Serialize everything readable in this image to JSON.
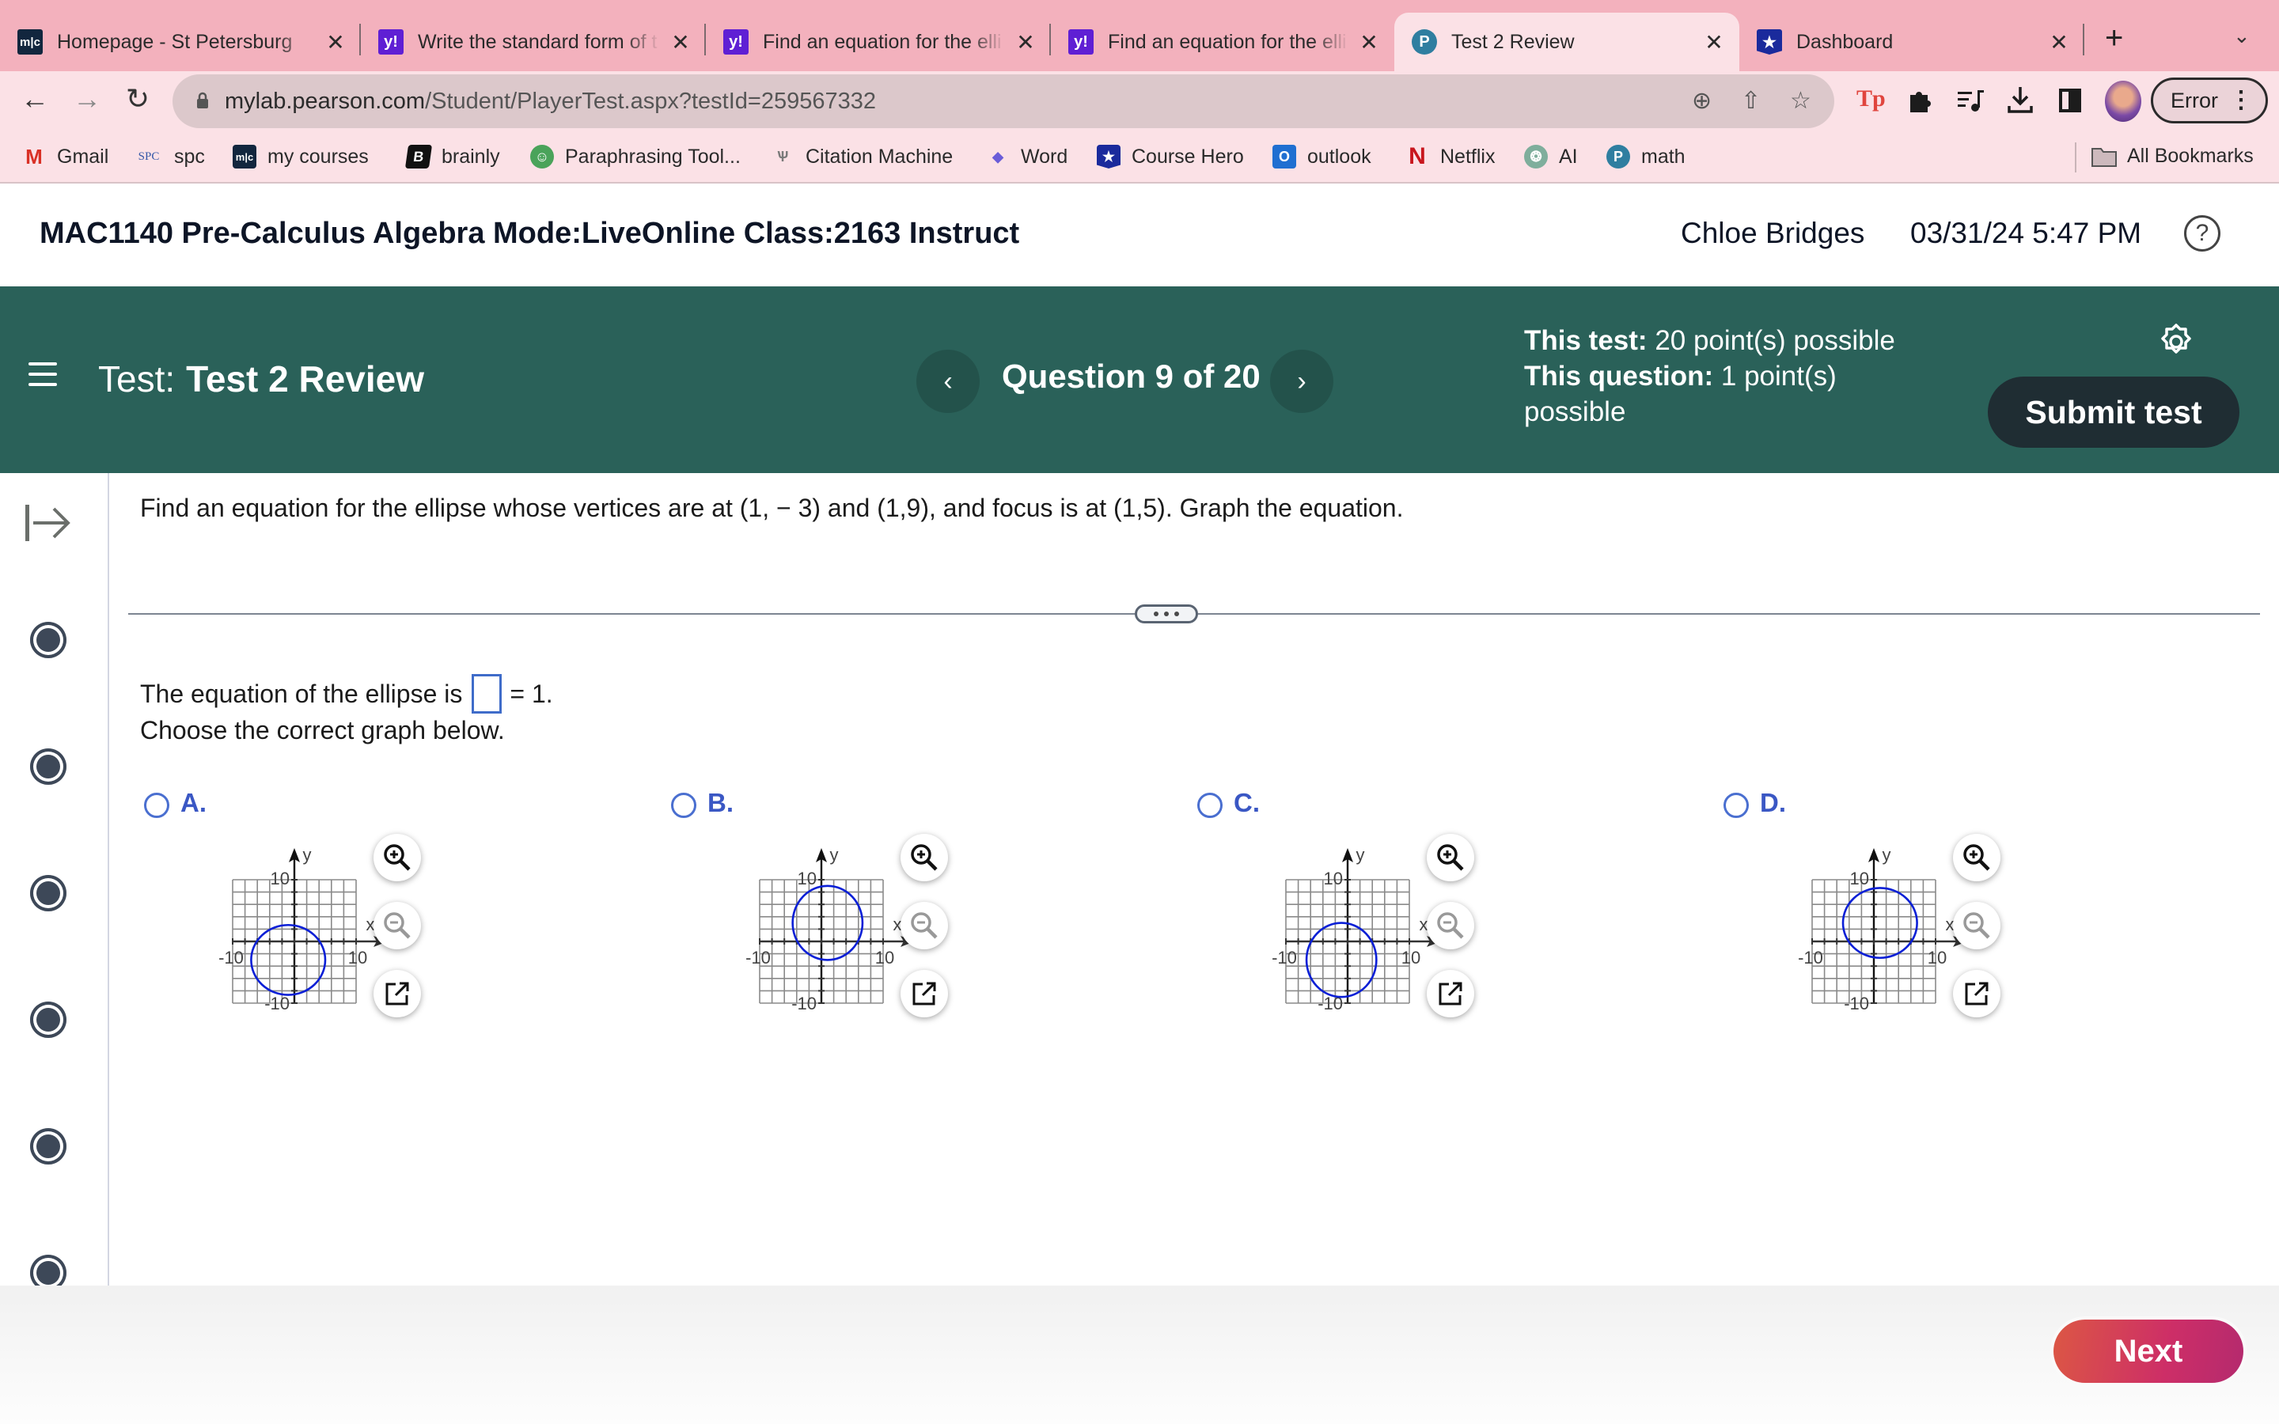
{
  "browser": {
    "tabs": [
      {
        "title": "Homepage - St Petersburg",
        "favicon": "mlc-icon",
        "favicon_text": "m|c",
        "active": false
      },
      {
        "title": "Write the standard form of t",
        "favicon": "yahoo-icon",
        "favicon_text": "y!",
        "active": false
      },
      {
        "title": "Find an equation for the elli",
        "favicon": "yahoo-icon",
        "favicon_text": "y!",
        "active": false
      },
      {
        "title": "Find an equation for the elli",
        "favicon": "yahoo-icon",
        "favicon_text": "y!",
        "active": false
      },
      {
        "title": "Test 2 Review",
        "favicon": "pearson-icon",
        "favicon_text": "P",
        "active": true
      },
      {
        "title": "Dashboard",
        "favicon": "course-hero-icon",
        "favicon_text": "★",
        "active": false
      }
    ],
    "tab_close_glyph": "✕",
    "new_tab_glyph": "+",
    "tab_dropdown_glyph": "⌄",
    "url_host": "mylab.pearson.com",
    "url_path": "/Student/PlayerTest.aspx?testId=259567332",
    "profile_button_label": "Error",
    "bookmarks": [
      {
        "label": "Gmail",
        "icon": "gmail-icon",
        "glyph": "M"
      },
      {
        "label": "spc",
        "icon": "spc-icon",
        "glyph": "SPC"
      },
      {
        "label": "my courses",
        "icon": "mlc-icon",
        "glyph": "m|c"
      },
      {
        "label": "brainly",
        "icon": "brainly-icon",
        "glyph": "B"
      },
      {
        "label": "Paraphrasing Tool...",
        "icon": "quillbot-icon",
        "glyph": "☺"
      },
      {
        "label": "Citation Machine",
        "icon": "citation-machine-icon",
        "glyph": "Ѱ"
      },
      {
        "label": "Word",
        "icon": "word-icon",
        "glyph": "◆"
      },
      {
        "label": "Course Hero",
        "icon": "course-hero-icon",
        "glyph": "★"
      },
      {
        "label": "outlook",
        "icon": "outlook-icon",
        "glyph": "O"
      },
      {
        "label": "Netflix",
        "icon": "netflix-icon",
        "glyph": "N"
      },
      {
        "label": "AI",
        "icon": "chatgpt-icon",
        "glyph": "❂"
      },
      {
        "label": "math",
        "icon": "pearson-icon",
        "glyph": "P"
      }
    ],
    "all_bookmarks_label": "All Bookmarks"
  },
  "course": {
    "title": "MAC1140 Pre-Calculus Algebra Mode:LiveOnline Class:2163 Instruct",
    "user": "Chloe Bridges",
    "datetime": "03/31/24 5:47 PM",
    "help_glyph": "?"
  },
  "test": {
    "label": "Test:",
    "name": "Test 2 Review",
    "question_counter": "Question 9 of 20",
    "prev_glyph": "‹",
    "next_glyph": "›",
    "this_test_label": "This test:",
    "this_test_value": "20 point(s) possible",
    "this_question_label": "This question:",
    "this_question_value": "1 point(s) possible",
    "submit_label": "Submit test",
    "current_question": 9,
    "total_questions": 20
  },
  "question": {
    "prompt": "Find an equation for the ellipse whose vertices are at (1, − 3) and (1,9), and focus is at (1,5). Graph the equation.",
    "answer_prefix": "The equation of the ellipse is",
    "answer_value": "",
    "answer_suffix": "= 1.",
    "choose_text": "Choose the correct graph below.",
    "choices": [
      {
        "letter": "A.",
        "selected": false,
        "ellipse": {
          "cx": -1,
          "cy": -3,
          "rx": 6,
          "ry": 5.66
        }
      },
      {
        "letter": "B.",
        "selected": false,
        "ellipse": {
          "cx": 1,
          "cy": 3,
          "rx": 5.66,
          "ry": 6
        }
      },
      {
        "letter": "C.",
        "selected": false,
        "ellipse": {
          "cx": -1,
          "cy": -3,
          "rx": 5.66,
          "ry": 6
        }
      },
      {
        "letter": "D.",
        "selected": false,
        "ellipse": {
          "cx": 1,
          "cy": 3,
          "rx": 6,
          "ry": 5.66
        }
      }
    ],
    "graph_axes": {
      "xlabel": "x",
      "ylabel": "y",
      "xlim": [
        -10,
        10
      ],
      "ylim": [
        -10,
        10
      ],
      "grid_step": 2,
      "tick_labels": {
        "x_min": "-10",
        "x_max": "10",
        "y_min": "-10",
        "y_max": "10"
      }
    },
    "colors": {
      "ellipse": "#0a1fd6",
      "grid": "#8a8a8a",
      "axis": "#333333"
    }
  },
  "footer": {
    "next_label": "Next"
  },
  "colors": {
    "tabbar": "#f3b1bd",
    "toolbar": "#fbe1e6",
    "test_band": "#2a6159",
    "submit": "#1f2d33",
    "choice_accent": "#3a57c4",
    "next_gradient_start": "#dc5744",
    "next_gradient_end": "#b42a6e"
  }
}
